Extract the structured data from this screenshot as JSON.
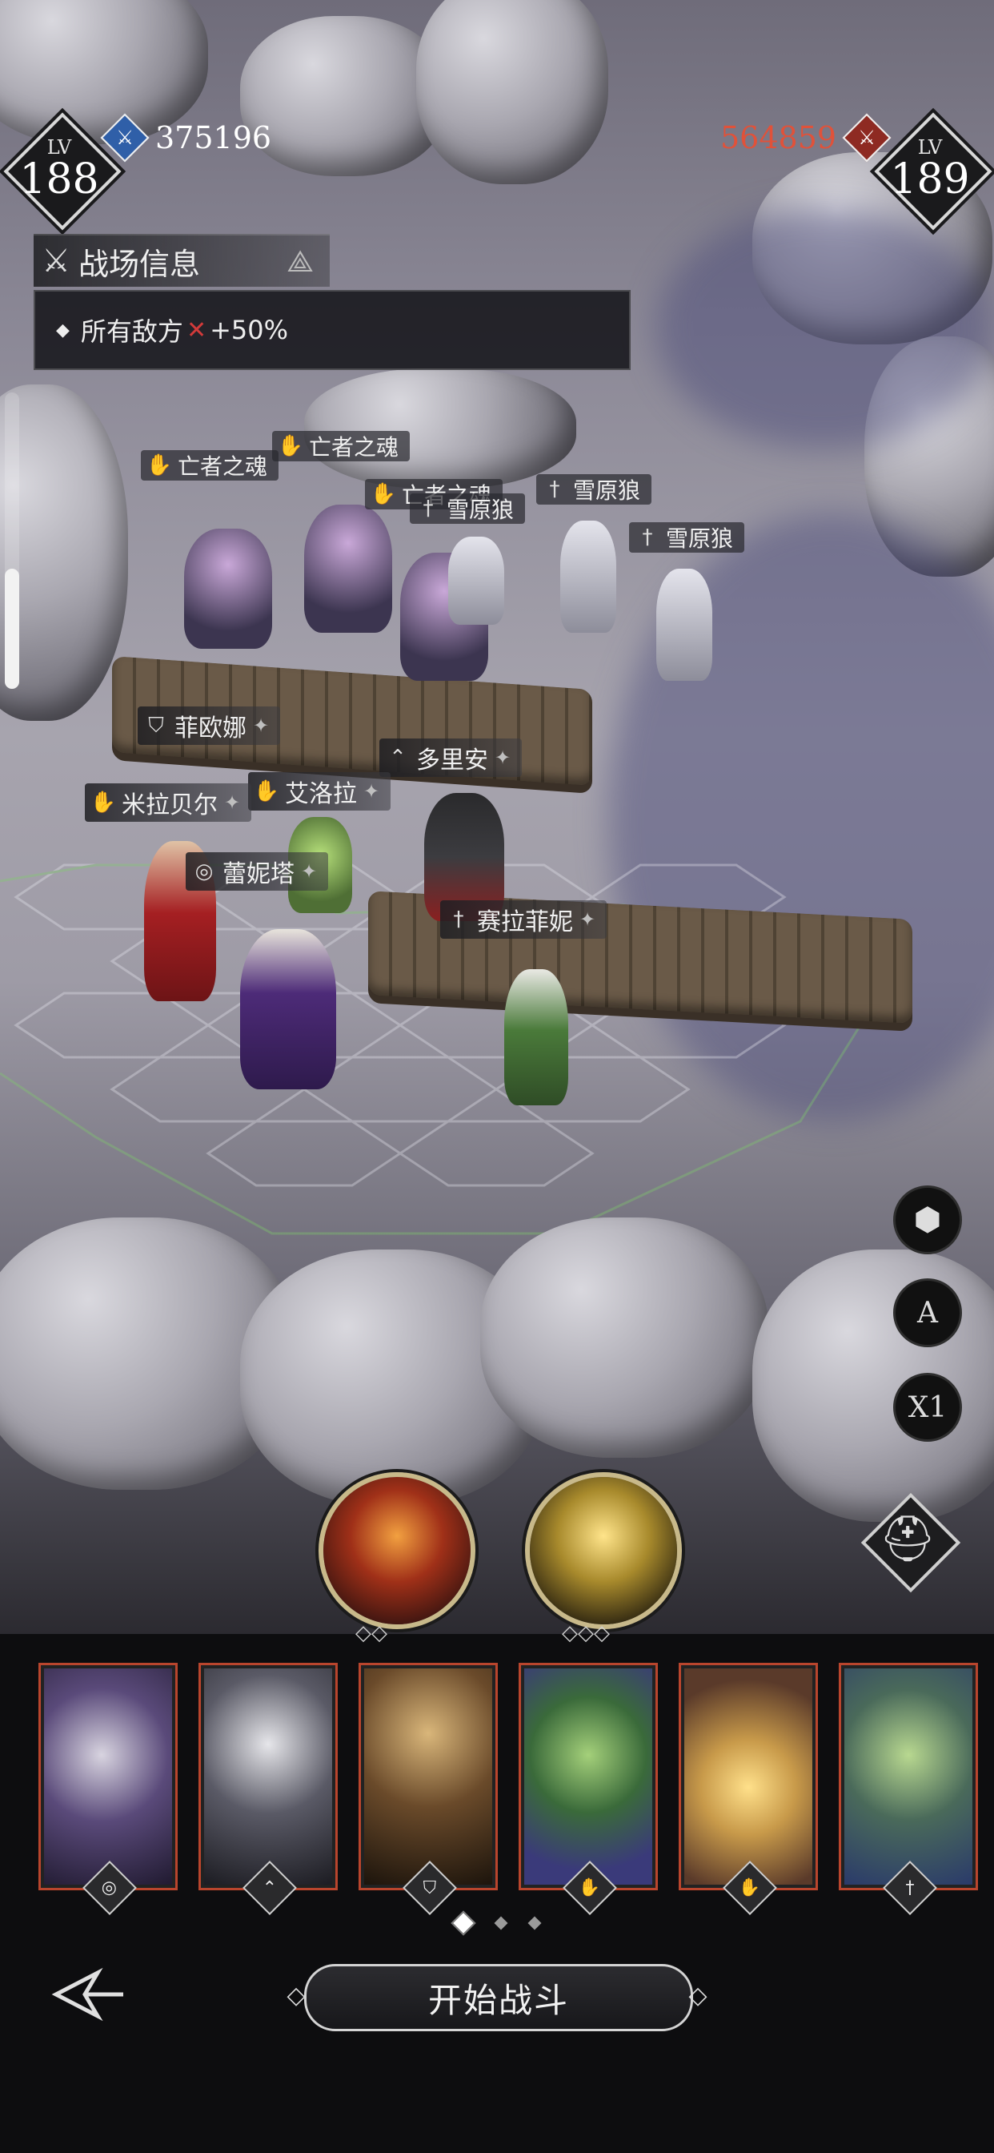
{
  "player": {
    "lv_label": "LV",
    "level": "188",
    "power": "375196",
    "power_color": "#ffffff",
    "emblem": "blue-swords-icon"
  },
  "enemy": {
    "lv_label": "LV",
    "level": "189",
    "power": "564859",
    "power_color": "#e0523a",
    "emblem": "red-crest-icon"
  },
  "battlefield_info": {
    "title": "战场信息",
    "effect_prefix": "所有敌方",
    "effect_value": "+50%"
  },
  "enemy_units": [
    {
      "name": "亡者之魂",
      "icon": "palm-icon"
    },
    {
      "name": "亡者之魂",
      "icon": "palm-icon"
    },
    {
      "name": "亡者之魂",
      "icon": "palm-icon"
    },
    {
      "name": "雪原狼",
      "icon": "sword-icon"
    },
    {
      "name": "雪原狼",
      "icon": "sword-icon"
    },
    {
      "name": "雪原狼",
      "icon": "sword-icon"
    }
  ],
  "ally_units": [
    {
      "name": "菲欧娜",
      "icon": "shield-icon"
    },
    {
      "name": "多里安",
      "icon": "bow-icon"
    },
    {
      "name": "艾洛拉",
      "icon": "palm-icon"
    },
    {
      "name": "米拉贝尔",
      "icon": "palm-icon"
    },
    {
      "name": "蕾妮塔",
      "icon": "spiral-icon"
    },
    {
      "name": "赛拉菲妮",
      "icon": "sword-icon"
    }
  ],
  "controls": {
    "formation_icon": "hexagon-cluster-icon",
    "auto_label": "A",
    "speed_label": "X1",
    "helm_icon": "spartan-helmet-icon"
  },
  "hero_cards": [
    {
      "class_icon": "spiral-icon",
      "glyph": "◎"
    },
    {
      "class_icon": "bow-icon",
      "glyph": "⌃"
    },
    {
      "class_icon": "shield-icon",
      "glyph": "⛉"
    },
    {
      "class_icon": "palm-icon",
      "glyph": "✋"
    },
    {
      "class_icon": "palm-icon",
      "glyph": "✋"
    },
    {
      "class_icon": "sword-icon",
      "glyph": "†"
    }
  ],
  "footer": {
    "start_label": "开始战斗"
  }
}
